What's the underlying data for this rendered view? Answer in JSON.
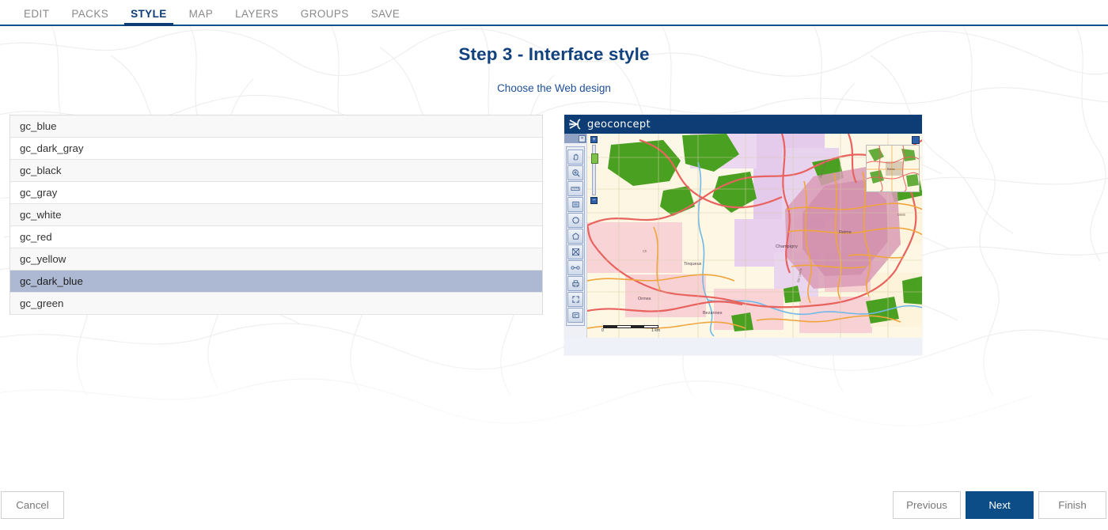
{
  "nav": {
    "items": [
      {
        "label": "EDIT",
        "active": false
      },
      {
        "label": "PACKS",
        "active": false
      },
      {
        "label": "STYLE",
        "active": true
      },
      {
        "label": "MAP",
        "active": false
      },
      {
        "label": "LAYERS",
        "active": false
      },
      {
        "label": "GROUPS",
        "active": false
      },
      {
        "label": "SAVE",
        "active": false
      }
    ]
  },
  "header": {
    "title": "Step 3 - Interface style",
    "subtitle": "Choose the Web design",
    "title_color": "#12427e",
    "subtitle_color": "#1e4f99"
  },
  "style_list": {
    "selected": "gc_dark_blue",
    "items": [
      {
        "label": "gc_blue"
      },
      {
        "label": "gc_dark_gray"
      },
      {
        "label": "gc_black"
      },
      {
        "label": "gc_gray"
      },
      {
        "label": "gc_white"
      },
      {
        "label": "gc_red"
      },
      {
        "label": "gc_yellow"
      },
      {
        "label": "gc_dark_blue"
      },
      {
        "label": "gc_green"
      }
    ],
    "selected_bg": "#adb9d3"
  },
  "preview": {
    "banner": {
      "brand": "geoconcept",
      "bg": "#0e3c74"
    },
    "collapse_label": "«",
    "toolbar_tools": [
      "pan-hand-icon",
      "zoom-in-icon",
      "measure-ruler-icon",
      "select-rectangle-icon",
      "circle-select-icon",
      "polygon-select-icon",
      "route-icon",
      "distance-icon",
      "print-icon",
      "fullscreen-icon",
      "legend-icon"
    ],
    "zoom": {
      "plus_label": "+",
      "minus_label": "−"
    },
    "scalebar": {
      "left_label": "0",
      "right_label": "1 km"
    },
    "map_labels": [
      "Reims",
      "Tinqueux",
      "Champigny",
      "Cernay-lè",
      "Bezannes",
      "Ormes",
      "Du Général Giraud"
    ]
  },
  "footer": {
    "cancel_label": "Cancel",
    "previous_label": "Previous",
    "next_label": "Next",
    "finish_label": "Finish",
    "primary_color": "#0c4d87"
  }
}
